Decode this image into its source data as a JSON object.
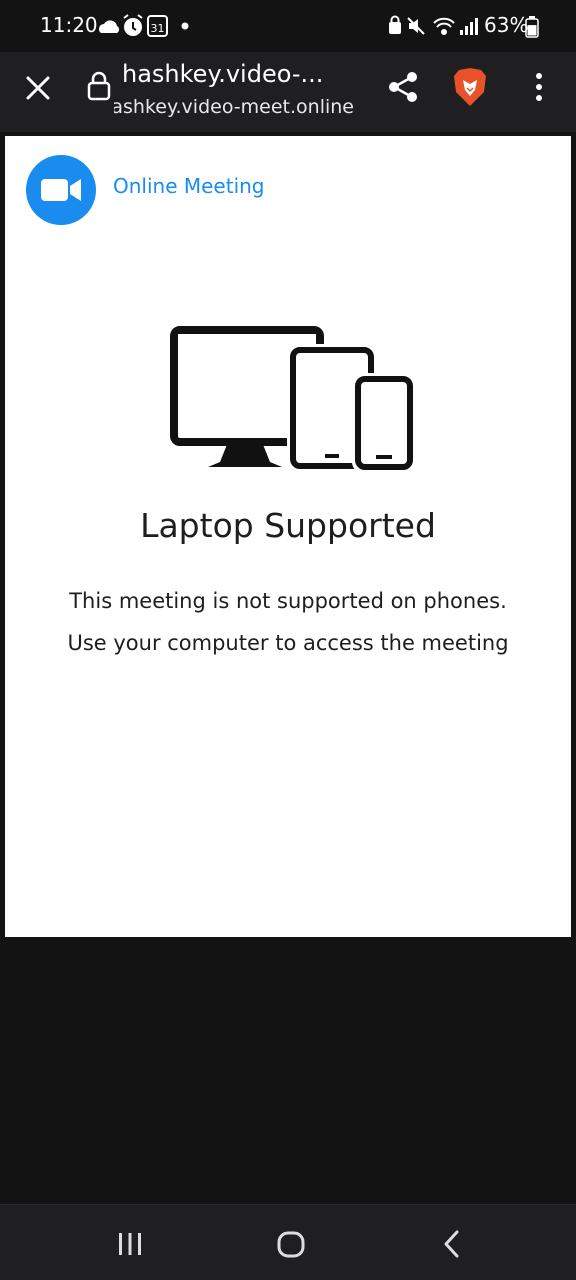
{
  "status_bar": {
    "time": "11:20",
    "calendar_day": "31",
    "battery_percent": "63%",
    "battery_level": 0.63
  },
  "browser": {
    "title": "hashkey.video-...",
    "url": "hashkey.video-meet.online"
  },
  "page": {
    "logo_text": "Online Meeting",
    "heading": "Laptop Supported",
    "line1": "This meeting is not supported on phones.",
    "line2": "Use your computer to access the meeting"
  },
  "colors": {
    "brand": "#1a8cf0",
    "brave": "#e8522a"
  },
  "icons": {
    "close": "close-icon",
    "lock": "lock-icon",
    "share": "share-icon",
    "brave": "brave-lion-icon",
    "menu": "more-vert-icon",
    "recents": "recents-icon",
    "home": "home-icon",
    "back": "back-icon"
  }
}
